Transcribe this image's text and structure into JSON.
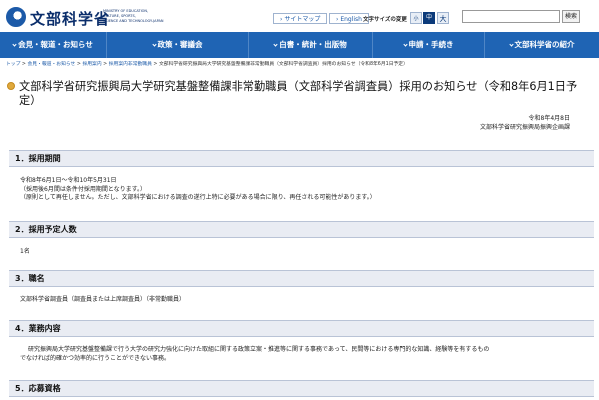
{
  "header": {
    "logo_text": "文部科学省",
    "logo_sub": [
      "MINISTRY OF EDUCATION,",
      "CULTURE, SPORTS,",
      "SCIENCE AND TECHNOLOGY-JAPAN"
    ],
    "sitemap_label": "サイトマップ",
    "english_label": "English",
    "font_size_label": "文字サイズの変更",
    "font_size_options": [
      "小",
      "中",
      "大"
    ],
    "search_button": "検索",
    "search_value": ""
  },
  "nav": [
    "会見・報道・お知らせ",
    "政策・審議会",
    "白書・統計・出版物",
    "申請・手続き",
    "文部科学省の紹介"
  ],
  "breadcrumb": {
    "links": [
      "トップ",
      "会見・報道・お知らせ",
      "採用案内",
      "採用案内非常勤職員"
    ],
    "current": "文部科学省研究振興局大学研究基盤整備課非常勤職員（文部科学省調査員）採用のお知らせ（令和8年6月1日予定）"
  },
  "page": {
    "title": "文部科学省研究振興局大学研究基盤整備課非常勤職員（文部科学省調査員）採用のお知らせ（令和8年6月1日予定）",
    "date": "令和8年4月8日",
    "org": "文部科学省研究振興局振興企画課"
  },
  "sections": [
    {
      "heading": "1．採用期間",
      "lines": [
        "令和8年6月1日～令和10年5月31日",
        "（採用後6月間は条件付採用期間となります。）",
        "（原則として再任しません。ただし、文部科学省における調査の遂行上特に必要がある場合に限り、再任される可能性があります。）"
      ]
    },
    {
      "heading": "2．採用予定人数",
      "lines": [
        "1名"
      ]
    },
    {
      "heading": "3．職名",
      "lines": [
        "文部科学省調査員（調査員または上席調査員）（非常勤職員）"
      ]
    },
    {
      "heading": "4．業務内容",
      "lines": [
        "研究振興局大学研究基盤整備課で行う大学の研究力強化に向けた取組に関する政策立案・推進等に関する事務であって、民間等における専門的な知識、経験等を有するもの",
        "でなければ的確かつ効率的に行うことができない事務。"
      ]
    },
    {
      "heading": "5．応募資格",
      "lines": []
    }
  ],
  "colors": {
    "nav_bg": "#1f64b4",
    "section_bg": "#e9ecf3",
    "logo_color": "#0b2e6b",
    "title_bullet": "#e0a93c"
  }
}
